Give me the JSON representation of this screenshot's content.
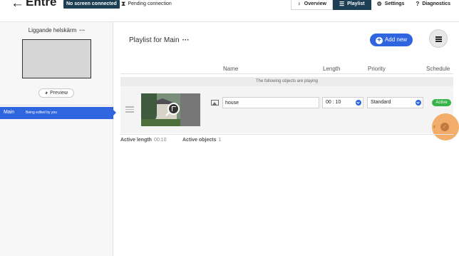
{
  "header": {
    "back_icon": "←",
    "title": "Entre",
    "connection_badge": "No screen connected",
    "pending_label": "Pending connection",
    "tabs": [
      {
        "label": "Overview",
        "icon": "lightbulb-icon",
        "glyph": "♀",
        "active": false
      },
      {
        "label": "Playlist",
        "icon": "list-icon",
        "glyph": "☰",
        "active": true
      },
      {
        "label": "Settings",
        "icon": "gear-icon",
        "glyph": "⚙",
        "active": false
      },
      {
        "label": "Diagnostics",
        "icon": "help-icon",
        "glyph": "?",
        "active": false
      }
    ]
  },
  "sidebar": {
    "screen_name": "Liggande helskärm",
    "screen_menu": "···",
    "preview_label": "Preview",
    "playlist_item": {
      "name": "Main",
      "status": "Being edited by you"
    }
  },
  "main": {
    "title": "Playlist for Main",
    "title_menu": "···",
    "add_new_label": "Add new",
    "columns": {
      "name": "Name",
      "length": "Length",
      "priority": "Priority",
      "schedule": "Schedule"
    },
    "playing_notice": "The following objects are playing",
    "items": [
      {
        "name": "house",
        "length": "00 : 10",
        "priority": "Standard",
        "schedule": "Active"
      }
    ],
    "summary": {
      "active_length_label": "Active length",
      "active_length_value": "00:10",
      "active_objects_label": "Active objects",
      "active_objects_value": "1"
    }
  },
  "colors": {
    "accent": "#2f66e0",
    "header_dark": "#1c3f55",
    "active_green": "#38b34a",
    "cursor_orange": "#f0a050"
  }
}
